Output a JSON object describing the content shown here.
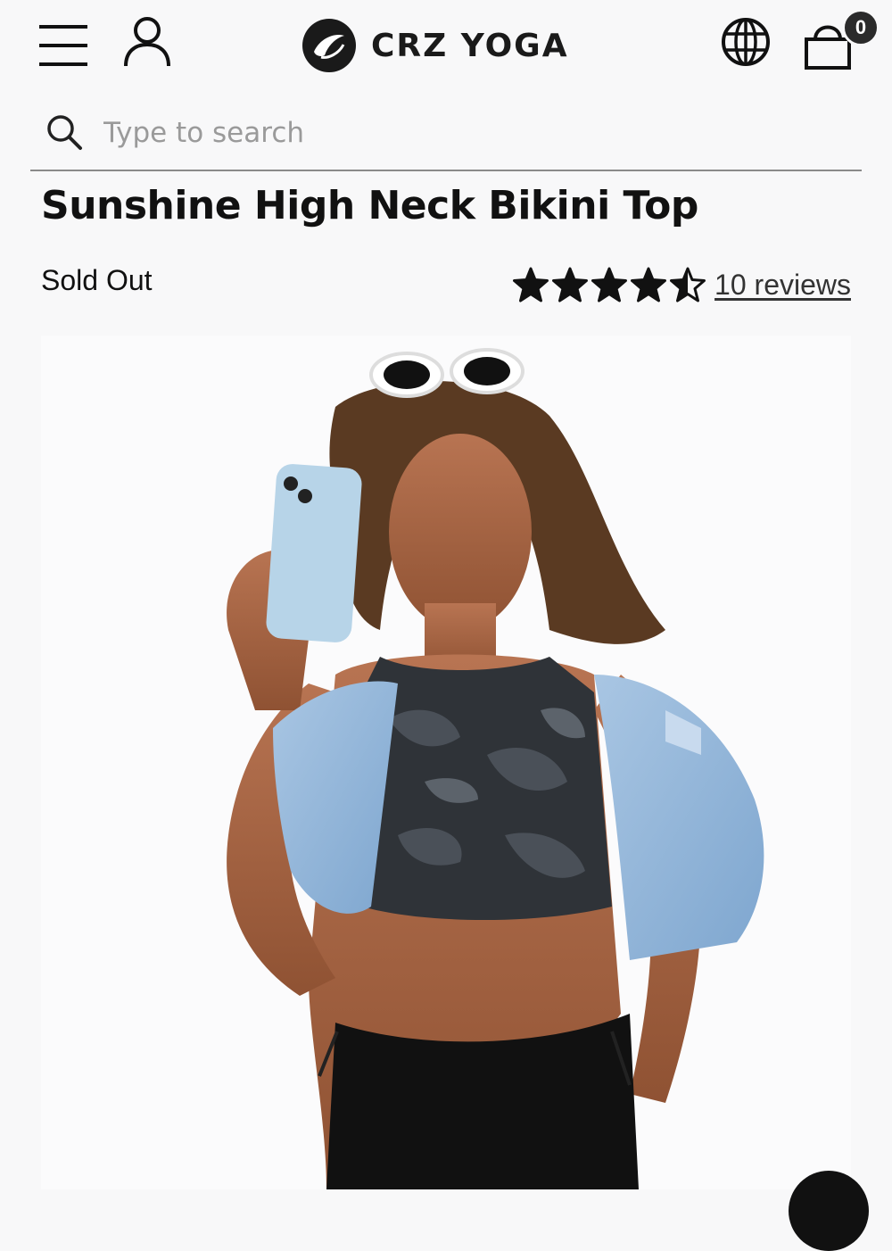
{
  "header": {
    "brand_name": "CRZ YOGA",
    "cart_count": "0",
    "icons": [
      "menu-icon",
      "account-icon",
      "brand-logo-icon",
      "globe-icon",
      "cart-icon"
    ]
  },
  "search": {
    "placeholder": "Type to search",
    "value": "",
    "icon": "search-icon"
  },
  "product": {
    "title": "Sunshine High Neck Bikini Top",
    "stock_status": "Sold Out",
    "rating": {
      "value": 4.5,
      "max": 5,
      "reviews_label": "10 reviews"
    },
    "image": {
      "alt": "Model wearing a camo high neck bikini top with a denim jacket draped over shoulders, holding a phone"
    }
  },
  "colors": {
    "background": "#f8f8f9",
    "text": "#111111",
    "divider": "#8a8a8a",
    "badge": "#2b2b2b"
  }
}
